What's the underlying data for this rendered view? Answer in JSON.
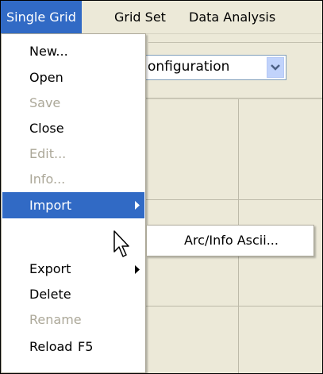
{
  "menubar": {
    "items": [
      {
        "label": "Single Grid"
      },
      {
        "label": "Grid Set"
      },
      {
        "label": "Data Analysis"
      }
    ]
  },
  "toolbar": {
    "combo_value": "onfiguration"
  },
  "dropdown": {
    "items": [
      {
        "label": "New...",
        "enabled": true
      },
      {
        "label": "Open",
        "enabled": true
      },
      {
        "label": "Save",
        "enabled": false
      },
      {
        "label": "Close",
        "enabled": true
      },
      {
        "label": "Edit...",
        "enabled": false
      },
      {
        "label": "Info...",
        "enabled": false
      },
      {
        "label": "Import",
        "enabled": true,
        "submenu": true,
        "highlighted": true
      },
      {
        "label": "Export",
        "enabled": true,
        "submenu": true
      },
      {
        "label": "Delete",
        "enabled": true
      },
      {
        "label": "Rename",
        "enabled": false
      },
      {
        "label": "Reload",
        "enabled": true,
        "shortcut": "F5"
      }
    ]
  },
  "submenu": {
    "items": [
      {
        "label": "Arc/Info Ascii..."
      }
    ]
  },
  "colors": {
    "highlight": "#316ac5",
    "menubar_bg": "#ece9d8",
    "disabled_text": "#aca899"
  }
}
